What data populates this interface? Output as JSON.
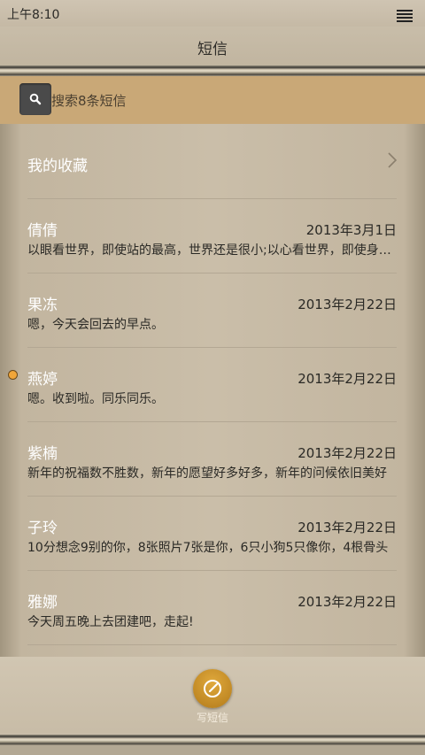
{
  "status_bar": {
    "time": "上午8:10",
    "menu_icon": "menu-icon"
  },
  "title": "短信",
  "search": {
    "placeholder": "搜索8条短信",
    "icon": "search-icon"
  },
  "favorites": {
    "label": "我的收藏",
    "icon": "chevron-right-icon"
  },
  "messages": [
    {
      "name": "倩倩",
      "date": "2013年3月1日",
      "preview": "以眼看世界，即使站的最高，世界还是很小;以心看世界，即使身处最低，世界也会很大",
      "unread": false
    },
    {
      "name": "果冻",
      "date": "2013年2月22日",
      "preview": "嗯，今天会回去的早点。",
      "unread": false
    },
    {
      "name": "燕婷",
      "date": "2013年2月22日",
      "preview": "嗯。收到啦。同乐同乐。",
      "unread": true
    },
    {
      "name": "紫楠",
      "date": "2013年2月22日",
      "preview": "新年的祝福数不胜数，新年的愿望好多好多，新年的问候依旧美好",
      "unread": false
    },
    {
      "name": "子玲",
      "date": "2013年2月22日",
      "preview": "10分想念9别的你，8张照片7张是你，6只小狗5只像你，4根骨头",
      "unread": false
    },
    {
      "name": "雅娜",
      "date": "2013年2月22日",
      "preview": "今天周五晚上去团建吧，走起!",
      "unread": false
    }
  ],
  "compose": {
    "label": "写短信",
    "icon": "compose-icon"
  },
  "colors": {
    "accent": "#c9a877",
    "unread_dot": "#f0a63a",
    "compose_button": "#d09a30"
  }
}
